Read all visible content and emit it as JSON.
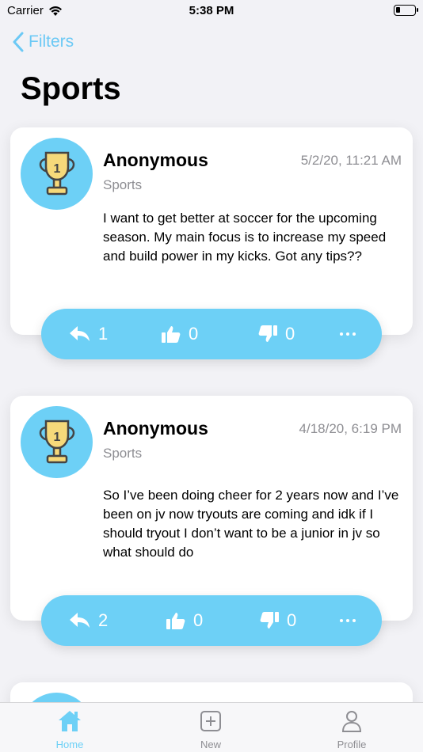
{
  "status": {
    "carrier": "Carrier",
    "time": "5:38 PM"
  },
  "nav": {
    "back_label": "Filters"
  },
  "page": {
    "title": "Sports"
  },
  "posts": [
    {
      "author": "Anonymous",
      "category": "Sports",
      "date": "5/2/20, 11:21 AM",
      "body": "I want to get better at soccer for the upcoming season. My main focus is to increase my speed and build power in my kicks. Got any tips??",
      "replies": "1",
      "likes": "0",
      "dislikes": "0",
      "avatar_badge": "1"
    },
    {
      "author": "Anonymous",
      "category": "Sports",
      "date": "4/18/20, 6:19 PM",
      "body": "So I’ve been doing cheer for 2 years now and I’ve been on jv now tryouts are coming and idk if I should tryout I don’t want to be a junior in jv so what should do",
      "replies": "2",
      "likes": "0",
      "dislikes": "0",
      "avatar_badge": "1"
    }
  ],
  "tabs": [
    {
      "label": "Home",
      "icon": "home-icon",
      "active": true
    },
    {
      "label": "New",
      "icon": "plus-square-icon",
      "active": false
    },
    {
      "label": "Profile",
      "icon": "person-icon",
      "active": false
    }
  ],
  "colors": {
    "accent": "#6dd0f6",
    "back": "#6cc9f5",
    "muted": "#8e8e93"
  }
}
